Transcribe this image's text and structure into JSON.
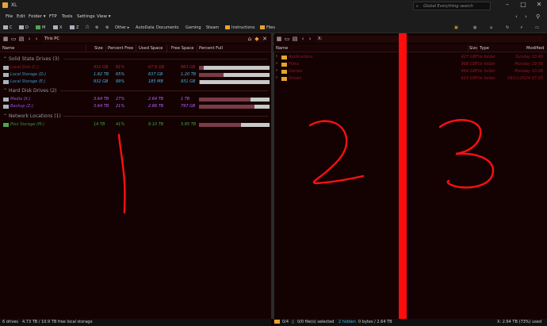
{
  "window": {
    "title": "XL",
    "search_placeholder": "Global Everything search"
  },
  "menu": [
    "File",
    "Edit",
    "Folder ▾",
    "FTP",
    "Tools",
    "Settings",
    "View ▾"
  ],
  "favorites": {
    "drives": [
      "C",
      "D",
      "M",
      "X",
      "Z"
    ],
    "other_label": "Other ▸",
    "folders": [
      "AutoData",
      "Documents",
      "Gaming",
      "Steam",
      "Instructions",
      "Files"
    ]
  },
  "left_pane": {
    "path": "This PC",
    "columns": [
      "Name",
      "Size",
      "Percent Free",
      "Used Space",
      "Free Space",
      "Percent Full"
    ],
    "groups": [
      {
        "label": "Solid State Drives (3)",
        "rows": [
          {
            "name": "Local Disk (C:)",
            "size": "931 GB",
            "pct_free": "81%",
            "used": "67.9 GB",
            "free": "863 GB",
            "full": 0.07,
            "color": "#b51d2a"
          },
          {
            "name": "Local Storage (D:)",
            "size": "1.82 TB",
            "pct_free": "65%",
            "used": "637 GB",
            "free": "1.20 TB",
            "full": 0.35,
            "color": "#3fb6e5"
          },
          {
            "name": "Local Storage (E:)",
            "size": "932 GB",
            "pct_free": "99%",
            "used": "185 MB",
            "free": "931 GB",
            "full": 0.01,
            "color": "#3fb6e5"
          }
        ]
      },
      {
        "label": "Hard Disk Drives (2)",
        "rows": [
          {
            "name": "Media (X:)",
            "size": "3.64 TB",
            "pct_free": "27%",
            "used": "2.64 TB",
            "free": "1 TB",
            "full": 0.73,
            "color": "#b760ff"
          },
          {
            "name": "Backup (Z:)",
            "size": "3.64 TB",
            "pct_free": "21%",
            "used": "2.86 TB",
            "free": "797 GB",
            "full": 0.79,
            "color": "#b760ff"
          }
        ]
      },
      {
        "label": "Network Locations (1)",
        "rows": [
          {
            "name": "Plex Storage (M:)",
            "size": "14 TB",
            "pct_free": "41%",
            "used": "9.10 TB",
            "free": "5.85 TB",
            "full": 0.59,
            "color": "#3aa83a"
          }
        ]
      }
    ],
    "status_drives": "6 drives",
    "status_storage": "4.73 TB / 10.9 TB free local storage"
  },
  "right_pane": {
    "path": "X:",
    "columns": [
      "Name",
      "Size",
      "Type",
      "Modified"
    ],
    "rows": [
      {
        "name": "Applications",
        "size": "427 GB",
        "type": "File folder",
        "modified": "Sunday 10:49"
      },
      {
        "name": "Films",
        "size": "968 GB",
        "type": "File folder",
        "modified": "Monday 19:56"
      },
      {
        "name": "Games",
        "size": "664 GB",
        "type": "File folder",
        "modified": "Monday 10:26"
      },
      {
        "name": "Shows",
        "size": "614 GB",
        "type": "File folder",
        "modified": "09/11/2024 07:03"
      }
    ],
    "status_count": "0/4",
    "status_selected": "0/0 file(s) selected",
    "status_hidden": "2 hidden",
    "status_bytes": "0 bytes / 2.64 TB",
    "status_used": "X: 2.64 TB (73%) used"
  },
  "annotations": [
    "1",
    "2",
    "3"
  ],
  "colors": {
    "background": "#140203",
    "accent_red": "#ff0d0d",
    "bar_fill": "#7a3b47"
  }
}
